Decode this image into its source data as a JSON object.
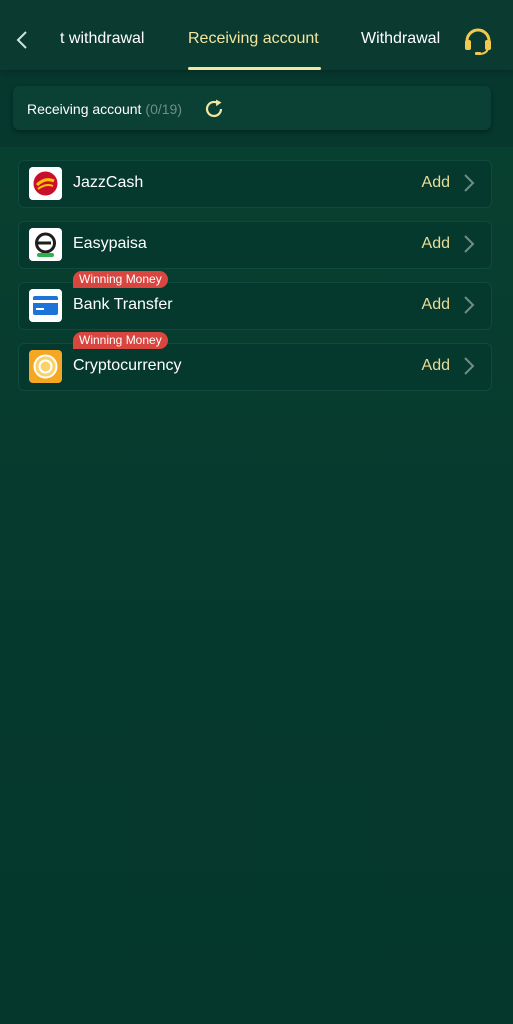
{
  "header": {
    "tabs": [
      {
        "label": "t withdrawal"
      },
      {
        "label": "Receiving account",
        "active": true
      },
      {
        "label": "Withdrawal"
      }
    ],
    "back_icon": "chevron-left-icon",
    "support_icon": "headset-icon",
    "accent_color": "#f2e6a0"
  },
  "receiving": {
    "title": "Receiving account",
    "count": "(0/19)",
    "refresh_icon": "refresh-icon"
  },
  "methods": [
    {
      "label": "JazzCash",
      "action": "Add",
      "icon": "jazzcash-logo-icon",
      "badge": ""
    },
    {
      "label": "Easypaisa",
      "action": "Add",
      "icon": "easypaisa-logo-icon",
      "badge": ""
    },
    {
      "label": "Bank Transfer",
      "action": "Add",
      "icon": "bank-card-icon",
      "badge": "Winning Money"
    },
    {
      "label": "Cryptocurrency",
      "action": "Add",
      "icon": "crypto-coin-icon",
      "badge": "Winning Money"
    }
  ],
  "colors": {
    "background": "#06382e",
    "add_text": "#e8dc98",
    "badge": "#d9453f"
  }
}
